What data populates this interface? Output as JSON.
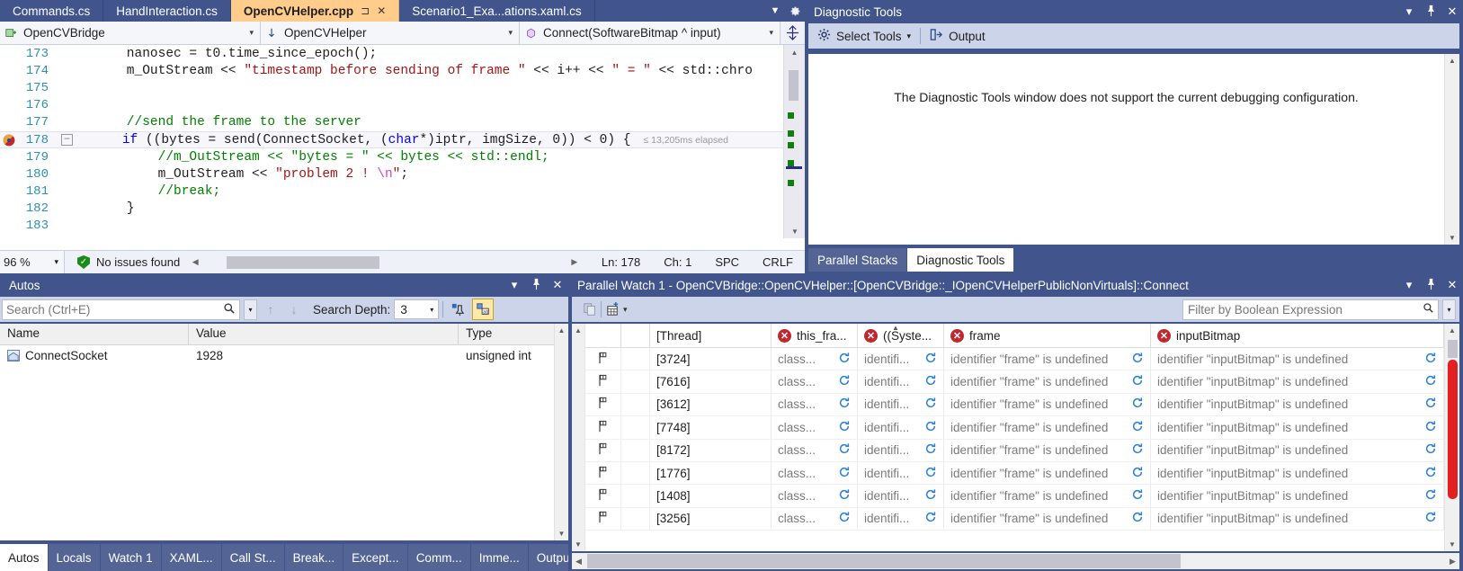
{
  "editor": {
    "tabs": [
      {
        "label": "Commands.cs",
        "active": false
      },
      {
        "label": "HandInteraction.cs",
        "active": false
      },
      {
        "label": "OpenCVHelper.cpp",
        "active": true,
        "pin": "⊐",
        "close": "✕"
      },
      {
        "label": "Scenario1_Exa...ations.xaml.cs",
        "active": false
      }
    ],
    "tabstrip_overflow_icon": "chevron-down-icon",
    "tabstrip_settings_icon": "gear-icon",
    "navbar": {
      "project": "OpenCVBridge",
      "project_icon": "class-icon",
      "member_scope": "OpenCVHelper",
      "member_scope_icon": "down-arrow-icon",
      "function": "Connect(SoftwareBitmap ^ input)",
      "function_icon": "method-icon",
      "split_icon": "split-window-icon",
      "dropdown_arrow": "▾"
    },
    "lines": [
      {
        "num": "173",
        "fold": "",
        "current": false,
        "tokens": [
          {
            "t": "    nanosec = t0.time_since_epoch();",
            "c": "op"
          }
        ]
      },
      {
        "num": "174",
        "fold": "",
        "current": false,
        "tokens": [
          {
            "t": "    m_OutStream << ",
            "c": "op"
          },
          {
            "t": "\"timestamp before sending of frame \"",
            "c": "s"
          },
          {
            "t": " << i++ << ",
            "c": "op"
          },
          {
            "t": "\" = \"",
            "c": "s"
          },
          {
            "t": " << std::chro",
            "c": "op"
          }
        ]
      },
      {
        "num": "175",
        "fold": "",
        "current": false,
        "tokens": []
      },
      {
        "num": "176",
        "fold": "",
        "current": false,
        "tokens": []
      },
      {
        "num": "177",
        "fold": "",
        "current": false,
        "tokens": [
          {
            "t": "    //send the frame to the server",
            "c": "c"
          }
        ]
      },
      {
        "num": "178",
        "fold": "−",
        "current": true,
        "breakpoint": "breakpoint-glyph",
        "perf": "≤ 13,205ms elapsed",
        "tokens": [
          {
            "t": "    ",
            "c": "op"
          },
          {
            "t": "if",
            "c": "k"
          },
          {
            "t": " ((bytes = send(ConnectSocket, (",
            "c": "op"
          },
          {
            "t": "char",
            "c": "k"
          },
          {
            "t": "*)iptr, imgSize, 0)) < 0) {",
            "c": "op"
          }
        ]
      },
      {
        "num": "179",
        "fold": "",
        "current": false,
        "tokens": [
          {
            "t": "        //m_OutStream << \"bytes = \" << bytes << std::endl;",
            "c": "c"
          }
        ]
      },
      {
        "num": "180",
        "fold": "",
        "current": false,
        "tokens": [
          {
            "t": "        m_OutStream << ",
            "c": "op"
          },
          {
            "t": "\"problem 2 ! ",
            "c": "s"
          },
          {
            "t": "\\n",
            "c": "esc"
          },
          {
            "t": "\"",
            "c": "s"
          },
          {
            "t": ";",
            "c": "op"
          }
        ]
      },
      {
        "num": "181",
        "fold": "",
        "current": false,
        "tokens": [
          {
            "t": "        //break;",
            "c": "c"
          }
        ]
      },
      {
        "num": "182",
        "fold": "",
        "current": false,
        "tokens": [
          {
            "t": "    }",
            "c": "op"
          }
        ]
      },
      {
        "num": "183",
        "fold": "",
        "current": false,
        "tokens": []
      }
    ],
    "status": {
      "zoom": "96 %",
      "zoom_arrow": "▾",
      "issues": "No issues found",
      "issues_icon": "shield-check-icon",
      "line": "Ln: 178",
      "char": "Ch: 1",
      "spaces": "SPC",
      "eol": "CRLF",
      "scroll_left_icon": "◀",
      "scroll_right_icon": "▶"
    }
  },
  "diagnostic_tools": {
    "title": "Diagnostic Tools",
    "window_buttons": {
      "dropdown": "▾",
      "pin": "⚲",
      "close": "✕"
    },
    "toolbar": {
      "select_tools": "Select Tools",
      "select_tools_icon": "gear-icon",
      "select_tools_arrow": "▾",
      "output": "Output",
      "output_icon": "output-arrow-icon"
    },
    "message": "The Diagnostic Tools window does not support the current debugging configuration.",
    "scroll": {
      "up": "▲",
      "down": "▼"
    },
    "tabs": [
      {
        "label": "Parallel Stacks",
        "active": false
      },
      {
        "label": "Diagnostic Tools",
        "active": true
      }
    ]
  },
  "autos": {
    "title": "Autos",
    "window_buttons": {
      "dropdown": "▾",
      "pin": "⚲",
      "close": "✕"
    },
    "toolbar": {
      "search_placeholder": "Search (Ctrl+E)",
      "search_value": "",
      "search_icon": "magnifier-icon",
      "search_dropdown_icon": "chevron-down-icon",
      "prev_icon": "arrow-up-icon",
      "next_icon": "arrow-down-icon",
      "search_depth_label": "Search Depth:",
      "search_depth_value": "3",
      "search_depth_arrow": "▾",
      "pin_tool_icon": "pin-column-icon",
      "hex_toggle_icon": "hex-display-icon"
    },
    "columns": [
      "Name",
      "Value",
      "Type"
    ],
    "rows": [
      {
        "name": "ConnectSocket",
        "value": "1928",
        "type": "unsigned int",
        "icon": "variable-icon"
      }
    ],
    "scroll": {
      "up": "▲",
      "down": "▼"
    },
    "tabs": [
      {
        "label": "Autos",
        "active": true
      },
      {
        "label": "Locals",
        "active": false
      },
      {
        "label": "Watch 1",
        "active": false
      },
      {
        "label": "XAML...",
        "active": false
      },
      {
        "label": "Call St...",
        "active": false
      },
      {
        "label": "Break...",
        "active": false
      },
      {
        "label": "Except...",
        "active": false
      },
      {
        "label": "Comm...",
        "active": false
      },
      {
        "label": "Imme...",
        "active": false
      },
      {
        "label": "Output",
        "active": false
      }
    ]
  },
  "parallel_watch": {
    "title": "Parallel Watch 1 - OpenCVBridge::OpenCVHelper::[OpenCVBridge::_IOpenCVHelperPublicNonVirtuals]::Connect",
    "window_buttons": {
      "dropdown": "▾",
      "pin": "⚲",
      "close": "✕"
    },
    "toolbar": {
      "copy_icon": "copy-icon",
      "add_watch_icon": "add-watch-icon",
      "add_watch_arrow": "▾",
      "filter_placeholder": "Filter by Boolean Expression",
      "filter_value": "",
      "filter_icon": "magnifier-icon",
      "filter_dropdown_icon": "chevron-down-icon"
    },
    "columns": [
      {
        "label": "",
        "error": false
      },
      {
        "label": "",
        "error": false
      },
      {
        "label": "[Thread]",
        "error": false
      },
      {
        "label": "this_fra...",
        "error": true
      },
      {
        "label": "((Syste...",
        "error": true,
        "sorted": "▲"
      },
      {
        "label": "frame",
        "error": true
      },
      {
        "label": "inputBitmap",
        "error": true
      }
    ],
    "rows": [
      {
        "flag": "flag-icon",
        "thread": "[3724]",
        "this_fra": "class...",
        "syste": "identifi...",
        "frame": "identifier \"frame\" is undefined",
        "inputBitmap": "identifier \"inputBitmap\" is undefined"
      },
      {
        "flag": "flag-icon",
        "thread": "[7616]",
        "this_fra": "class...",
        "syste": "identifi...",
        "frame": "identifier \"frame\" is undefined",
        "inputBitmap": "identifier \"inputBitmap\" is undefined"
      },
      {
        "flag": "flag-icon",
        "thread": "[3612]",
        "this_fra": "class...",
        "syste": "identifi...",
        "frame": "identifier \"frame\" is undefined",
        "inputBitmap": "identifier \"inputBitmap\" is undefined"
      },
      {
        "flag": "flag-icon",
        "thread": "[7748]",
        "this_fra": "class...",
        "syste": "identifi...",
        "frame": "identifier \"frame\" is undefined",
        "inputBitmap": "identifier \"inputBitmap\" is undefined"
      },
      {
        "flag": "flag-icon",
        "thread": "[8172]",
        "this_fra": "class...",
        "syste": "identifi...",
        "frame": "identifier \"frame\" is undefined",
        "inputBitmap": "identifier \"inputBitmap\" is undefined"
      },
      {
        "flag": "flag-icon",
        "thread": "[1776]",
        "this_fra": "class...",
        "syste": "identifi...",
        "frame": "identifier \"frame\" is undefined",
        "inputBitmap": "identifier \"inputBitmap\" is undefined"
      },
      {
        "flag": "flag-icon",
        "thread": "[1408]",
        "this_fra": "class...",
        "syste": "identifi...",
        "frame": "identifier \"frame\" is undefined",
        "inputBitmap": "identifier \"inputBitmap\" is undefined"
      },
      {
        "flag": "flag-icon",
        "thread": "[3256]",
        "this_fra": "class...",
        "syste": "identifi...",
        "frame": "identifier \"frame\" is undefined",
        "inputBitmap": "identifier \"inputBitmap\" is undefined"
      }
    ],
    "refresh_icon": "refresh-icon",
    "scroll": {
      "up": "▲",
      "down": "▼",
      "left": "◀",
      "right": "▶"
    }
  },
  "colors": {
    "chrome": "#41548b",
    "toolbar": "#ccd4ea",
    "active_tab": "#ffcc8c",
    "error": "#c1272d",
    "refresh": "#2b7fd4",
    "keyword": "#0000ff",
    "string": "#a31515",
    "comment": "#008000",
    "line_number": "#2b91af"
  }
}
